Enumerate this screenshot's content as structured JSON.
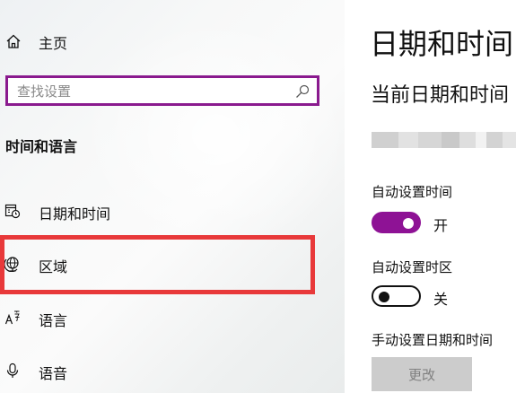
{
  "sidebar": {
    "home_label": "主页",
    "search": {
      "placeholder": "查找设置",
      "value": ""
    },
    "section_title": "时间和语言",
    "items": [
      {
        "label": "日期和时间",
        "icon": "calendar-clock-icon"
      },
      {
        "label": "区域",
        "icon": "globe-icon"
      },
      {
        "label": "语言",
        "icon": "language-icon"
      },
      {
        "label": "语音",
        "icon": "microphone-icon"
      }
    ]
  },
  "main": {
    "title": "日期和时间",
    "subheading": "当前日期和时间",
    "settings": {
      "auto_time": {
        "label": "自动设置时间",
        "state": "开",
        "on": true
      },
      "auto_zone": {
        "label": "自动设置时区",
        "state": "关",
        "on": false
      },
      "manual": {
        "label": "手动设置日期和时间",
        "button_label": "更改",
        "enabled": false
      }
    }
  },
  "colors": {
    "accent": "#8e1295",
    "search_border": "#8a1a8e",
    "highlight": "#e8393a",
    "disabled_button": "#cccccc"
  }
}
